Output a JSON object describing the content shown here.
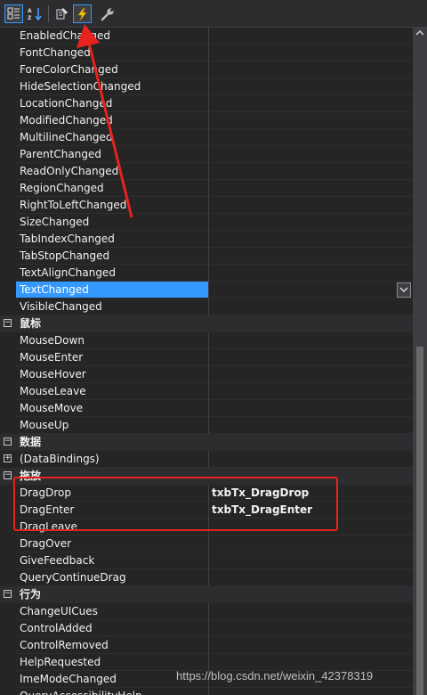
{
  "toolbar": {
    "buttons": [
      {
        "name": "categorized-icon"
      },
      {
        "name": "alphabetical-sort-icon"
      },
      {
        "name": "properties-icon"
      },
      {
        "name": "events-lightning-icon"
      },
      {
        "name": "property-pages-wrench-icon"
      }
    ]
  },
  "grid": {
    "rows": [
      {
        "type": "item",
        "name": "EnabledChanged"
      },
      {
        "type": "item",
        "name": "FontChanged"
      },
      {
        "type": "item",
        "name": "ForeColorChanged"
      },
      {
        "type": "item",
        "name": "HideSelectionChanged"
      },
      {
        "type": "item",
        "name": "LocationChanged"
      },
      {
        "type": "item",
        "name": "ModifiedChanged"
      },
      {
        "type": "item",
        "name": "MultilineChanged"
      },
      {
        "type": "item",
        "name": "ParentChanged"
      },
      {
        "type": "item",
        "name": "ReadOnlyChanged"
      },
      {
        "type": "item",
        "name": "RegionChanged"
      },
      {
        "type": "item",
        "name": "RightToLeftChanged"
      },
      {
        "type": "item",
        "name": "SizeChanged"
      },
      {
        "type": "item",
        "name": "TabIndexChanged"
      },
      {
        "type": "item",
        "name": "TabStopChanged"
      },
      {
        "type": "item",
        "name": "TextAlignChanged"
      },
      {
        "type": "item",
        "name": "TextChanged",
        "selected": true
      },
      {
        "type": "item",
        "name": "VisibleChanged"
      },
      {
        "type": "category",
        "name": "鼠标",
        "toggle": "−"
      },
      {
        "type": "item",
        "name": "MouseDown"
      },
      {
        "type": "item",
        "name": "MouseEnter"
      },
      {
        "type": "item",
        "name": "MouseHover"
      },
      {
        "type": "item",
        "name": "MouseLeave"
      },
      {
        "type": "item",
        "name": "MouseMove"
      },
      {
        "type": "item",
        "name": "MouseUp"
      },
      {
        "type": "category",
        "name": "数据",
        "toggle": "−"
      },
      {
        "type": "item",
        "name": "(DataBindings)",
        "toggle": "+"
      },
      {
        "type": "category",
        "name": "拖放",
        "toggle": "−"
      },
      {
        "type": "item",
        "name": "DragDrop",
        "value": "txbTx_DragDrop"
      },
      {
        "type": "item",
        "name": "DragEnter",
        "value": "txbTx_DragEnter"
      },
      {
        "type": "item",
        "name": "DragLeave"
      },
      {
        "type": "item",
        "name": "DragOver"
      },
      {
        "type": "item",
        "name": "GiveFeedback"
      },
      {
        "type": "item",
        "name": "QueryContinueDrag"
      },
      {
        "type": "category",
        "name": "行为",
        "toggle": "−"
      },
      {
        "type": "item",
        "name": "ChangeUICues"
      },
      {
        "type": "item",
        "name": "ControlAdded"
      },
      {
        "type": "item",
        "name": "ControlRemoved"
      },
      {
        "type": "item",
        "name": "HelpRequested"
      },
      {
        "type": "item",
        "name": "ImeModeChanged"
      },
      {
        "type": "item",
        "name": "QueryAccessibilityHelp"
      }
    ]
  },
  "watermark": "https://blog.csdn.net/weixin_42378319",
  "colors": {
    "background": "#252526",
    "selection": "#3399ff",
    "annotation": "#e8231d"
  }
}
